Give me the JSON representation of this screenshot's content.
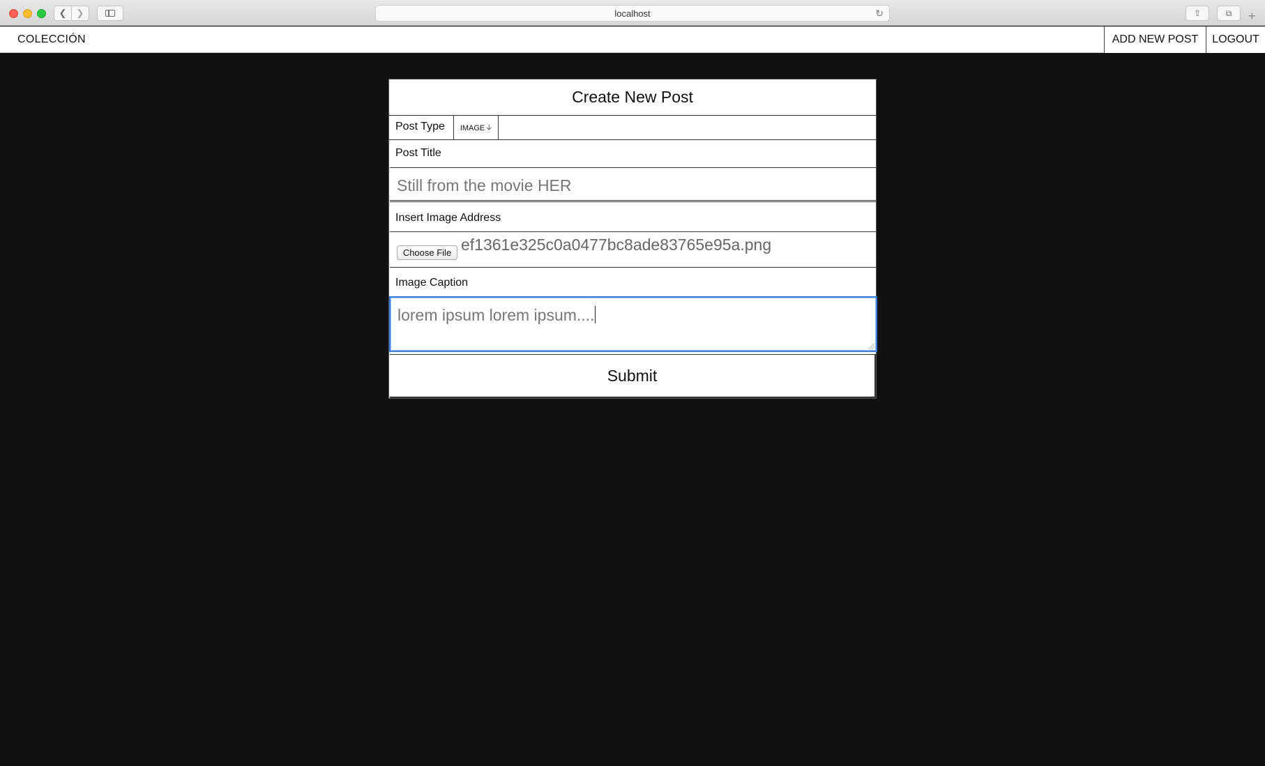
{
  "browser": {
    "url": "localhost",
    "icons": {
      "back": "chevron-left-icon",
      "forward": "chevron-right-icon",
      "sidebar": "sidebar-icon",
      "reload": "reload-icon",
      "share": "share-icon",
      "tabs": "tabs-icon",
      "new_tab": "plus-icon"
    }
  },
  "header": {
    "brand": "COLECCIÓN",
    "add_new_post": "ADD NEW POST",
    "logout": "LOGOUT"
  },
  "form": {
    "title": "Create New Post",
    "post_type_label": "Post Type",
    "post_type_value": "IMAGE",
    "post_title_label": "Post Title",
    "post_title_value": "Still from the movie HER",
    "image_address_label": "Insert Image Address",
    "choose_file_label": "Choose File",
    "file_name": "ef1361e325c0a0477bc8ade83765e95a.png",
    "caption_label": "Image Caption",
    "caption_value": "lorem ipsum lorem ipsum....",
    "submit_label": "Submit"
  },
  "colors": {
    "page_background": "#111111",
    "focus_ring": "#3b7ddd"
  }
}
